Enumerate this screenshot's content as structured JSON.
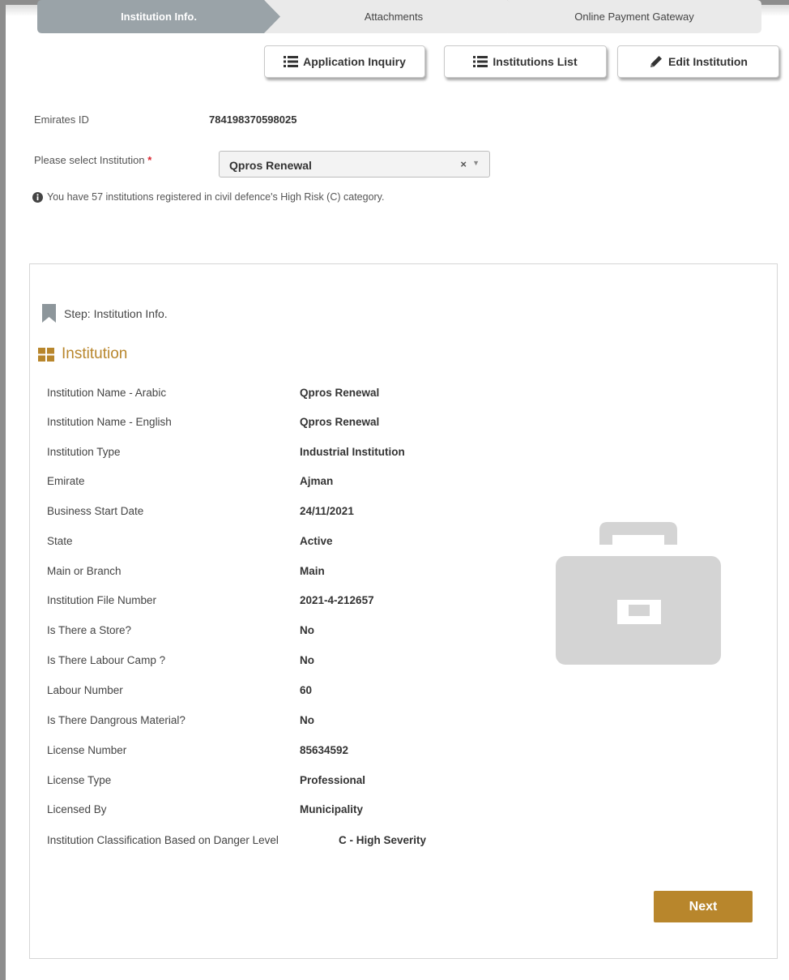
{
  "toolbar": {
    "application_inquiry": "Application Inquiry",
    "institutions_list": "Institutions List",
    "edit_institution": "Edit Institution"
  },
  "form": {
    "emirates_id_label": "Emirates ID",
    "emirates_id_value": "784198370598025",
    "institution_select_label": "Please select Institution",
    "required_mark": "*",
    "institution_selected": "Qpros Renewal",
    "clear_glyph": "×",
    "dropdown_glyph": "▼"
  },
  "info_message": "You have 57 institutions registered in civil defence's High Risk (C) category.",
  "wizard": {
    "steps": [
      {
        "label": "Institution Info.",
        "active": true
      },
      {
        "label": "Attachments",
        "active": false
      },
      {
        "label": "Online Payment Gateway",
        "active": false
      }
    ]
  },
  "step_indicator": "Step: Institution Info.",
  "section": {
    "title": "Institution",
    "rows": [
      {
        "label": "Institution Name - Arabic",
        "value": "Qpros Renewal"
      },
      {
        "label": "Institution Name - English",
        "value": "Qpros Renewal"
      },
      {
        "label": "Institution Type",
        "value": "Industrial Institution"
      },
      {
        "label": "Emirate",
        "value": "Ajman"
      },
      {
        "label": "Business Start Date",
        "value": "24/11/2021"
      },
      {
        "label": "State",
        "value": "Active"
      },
      {
        "label": "Main or Branch",
        "value": "Main"
      },
      {
        "label": "Institution File Number",
        "value": "2021-4-212657"
      },
      {
        "label": "Is There a Store?",
        "value": "No"
      },
      {
        "label": "Is There Labour Camp ?",
        "value": "No"
      },
      {
        "label": "Labour Number",
        "value": "60"
      },
      {
        "label": "Is There Dangrous Material?",
        "value": "No"
      },
      {
        "label": "License Number",
        "value": "85634592"
      },
      {
        "label": "License Type",
        "value": "Professional"
      },
      {
        "label": "Licensed By",
        "value": "Municipality"
      },
      {
        "label": "Institution Classification Based on Danger Level",
        "value": "C - High Severity"
      }
    ]
  },
  "actions": {
    "next": "Next"
  },
  "colors": {
    "accent": "#b8862c",
    "active_step": "#9aa3a8",
    "inactive_step": "#eaeaea",
    "required": "#d9232d"
  },
  "icons": {
    "list": "list-icon",
    "edit": "pencil-icon",
    "info": "info-circle-icon",
    "bookmark": "bookmark-icon",
    "grid": "grid-icon",
    "briefcase": "briefcase-icon"
  }
}
